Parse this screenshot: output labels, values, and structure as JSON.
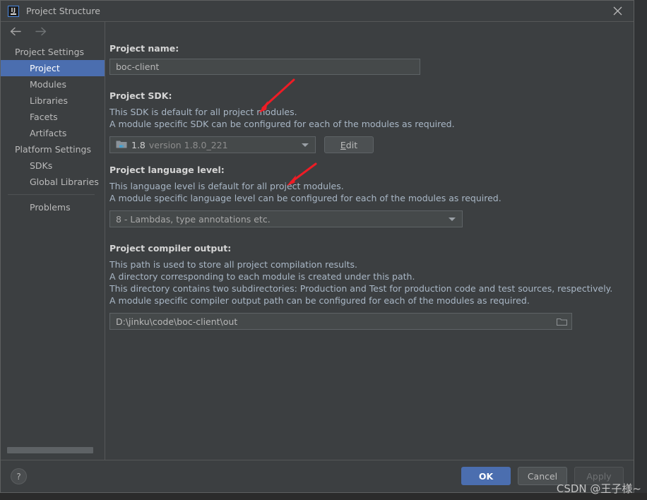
{
  "window": {
    "title": "Project Structure",
    "app_icon": "intellij-idea-icon",
    "close_icon": "close-icon"
  },
  "sidebar": {
    "back_icon": "arrow-left-icon",
    "forward_icon": "arrow-right-icon",
    "groups": [
      {
        "label": "Project Settings",
        "items": [
          {
            "label": "Project",
            "selected": true
          },
          {
            "label": "Modules",
            "selected": false
          },
          {
            "label": "Libraries",
            "selected": false
          },
          {
            "label": "Facets",
            "selected": false
          },
          {
            "label": "Artifacts",
            "selected": false
          }
        ]
      },
      {
        "label": "Platform Settings",
        "items": [
          {
            "label": "SDKs",
            "selected": false
          },
          {
            "label": "Global Libraries",
            "selected": false
          }
        ]
      }
    ],
    "problems_label": "Problems"
  },
  "main": {
    "project_name": {
      "label": "Project name:",
      "value": "boc-client"
    },
    "project_sdk": {
      "label": "Project SDK:",
      "description_lines": [
        "This SDK is default for all project modules.",
        "A module specific SDK can be configured for each of the modules as required."
      ],
      "icon": "java-sdk-folder-icon",
      "value_name": "1.8",
      "value_version": "version 1.8.0_221",
      "edit_button": {
        "mnemonic": "E",
        "rest": "dit"
      }
    },
    "language_level": {
      "label": "Project language level:",
      "description_lines": [
        "This language level is default for all project modules.",
        "A module specific language level can be configured for each of the modules as required."
      ],
      "value": "8 - Lambdas, type annotations etc."
    },
    "compiler_output": {
      "label": "Project compiler output:",
      "description_lines": [
        "This path is used to store all project compilation results.",
        "A directory corresponding to each module is created under this path.",
        "This directory contains two subdirectories: Production and Test for production code and test sources, respectively.",
        "A module specific compiler output path can be configured for each of the modules as required."
      ],
      "value": "D:\\jinku\\code\\boc-client\\out",
      "browse_icon": "folder-browse-icon"
    }
  },
  "footer": {
    "help_icon": "help-question-icon",
    "ok_label": "OK",
    "cancel_label": "Cancel",
    "apply_label": "Apply"
  },
  "annotations": {
    "arrow_sdk": "red-arrow-pointing-to-sdk-combo",
    "arrow_language_level": "red-arrow-pointing-to-language-level-combo",
    "arrow_color": "#ee1c25"
  },
  "watermark": {
    "text": "CSDN @王子様~"
  }
}
